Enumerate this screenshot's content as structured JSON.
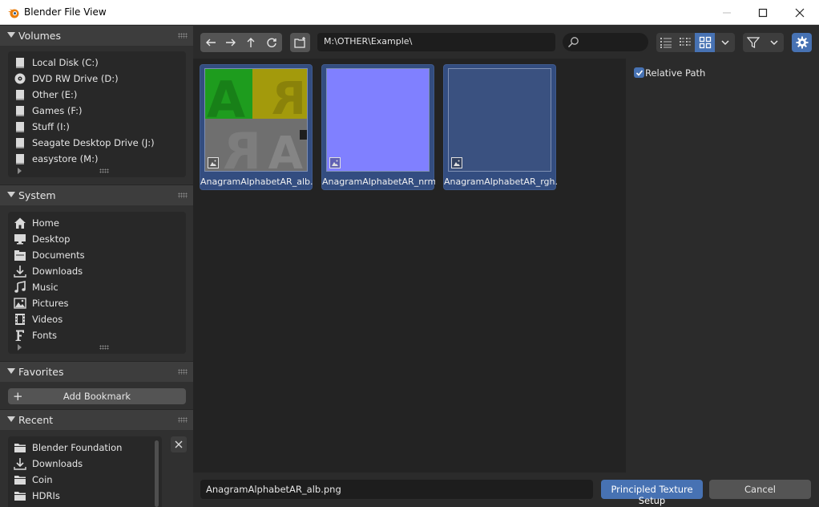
{
  "window": {
    "title": "Blender File View"
  },
  "sidebar": {
    "volumes": {
      "header": "Volumes",
      "items": [
        {
          "label": "Local Disk (C:)",
          "icon": "disk-icon"
        },
        {
          "label": "DVD RW Drive (D:)",
          "icon": "disc-icon"
        },
        {
          "label": "Other (E:)",
          "icon": "disk-icon"
        },
        {
          "label": "Games (F:)",
          "icon": "disk-icon"
        },
        {
          "label": "Stuff (I:)",
          "icon": "disk-icon"
        },
        {
          "label": "Seagate Desktop Drive (J:)",
          "icon": "disk-icon"
        },
        {
          "label": "easystore (M:)",
          "icon": "disk-icon"
        }
      ]
    },
    "system": {
      "header": "System",
      "items": [
        {
          "label": "Home",
          "icon": "home-icon"
        },
        {
          "label": "Desktop",
          "icon": "desktop-icon"
        },
        {
          "label": "Documents",
          "icon": "documents-icon"
        },
        {
          "label": "Downloads",
          "icon": "download-icon"
        },
        {
          "label": "Music",
          "icon": "music-icon"
        },
        {
          "label": "Pictures",
          "icon": "pictures-icon"
        },
        {
          "label": "Videos",
          "icon": "videos-icon"
        },
        {
          "label": "Fonts",
          "icon": "fonts-icon"
        }
      ]
    },
    "favorites": {
      "header": "Favorites",
      "add_bookmark": "Add Bookmark"
    },
    "recent": {
      "header": "Recent",
      "items": [
        {
          "label": "Blender Foundation",
          "icon": "folder-icon"
        },
        {
          "label": "Downloads",
          "icon": "download-icon"
        },
        {
          "label": "Coin",
          "icon": "folder-icon"
        },
        {
          "label": "HDRIs",
          "icon": "folder-icon"
        }
      ]
    }
  },
  "toolbar": {
    "path": "M:\\OTHER\\Example\\",
    "search_placeholder": "",
    "display_mode": "thumbnails"
  },
  "files": [
    {
      "name": "AnagramAlphabetAR_alb.p...",
      "kind": "albedo",
      "selected": true
    },
    {
      "name": "AnagramAlphabetAR_nrm....",
      "kind": "normal",
      "selected": true
    },
    {
      "name": "AnagramAlphabetAR_rgh.p...",
      "kind": "roughness",
      "selected": true
    }
  ],
  "options": {
    "relative_path_label": "Relative Path",
    "relative_path_checked": true
  },
  "bottom": {
    "filename": "AnagramAlphabetAR_alb.png",
    "primary_button": "Principled Texture Setup",
    "cancel_button": "Cancel"
  },
  "colors": {
    "accent": "#4772b3",
    "background": "#2b2b2b",
    "file_area": "#232323",
    "normal_map": "#8080ff",
    "roughness_tile": "#3a5180"
  }
}
